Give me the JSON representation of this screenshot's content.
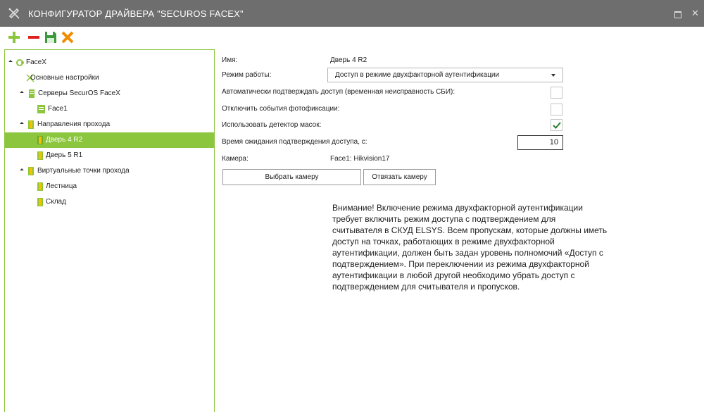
{
  "window": {
    "title": "КОНФИГУРАТОР ДРАЙВЕРА \"SECUROS FACEX\""
  },
  "toolbar": {
    "add_icon": "plus-icon",
    "remove_icon": "minus-icon",
    "save_icon": "save-icon",
    "cancel_icon": "close-icon",
    "accent": "#8cc63f"
  },
  "tree": {
    "root": "FaceX",
    "basic_settings": "Основные настройки",
    "servers": "Серверы SecurOS FaceX",
    "face1": "Face1",
    "directions": "Направления прохода",
    "door4": "Дверь 4 R2",
    "door5": "Дверь 5 R1",
    "virtual_points": "Виртуальные точки прохода",
    "stairs": "Лестница",
    "warehouse": "Склад"
  },
  "form": {
    "name_label": "Имя:",
    "name_value": "Дверь 4 R2",
    "mode_label": "Режим работы:",
    "mode_value": "Доступ в режиме двухфакторной аутентификации",
    "auto_confirm_label": "Автоматически подтверждать доступ (временная неисправность СБИ):",
    "auto_confirm_checked": false,
    "disable_photo_label": "Отключить события фотофиксации:",
    "disable_photo_checked": false,
    "mask_detector_label": "Использовать детектор масок:",
    "mask_detector_checked": true,
    "wait_time_label": "Время ожидания подтверждения доступа, с:",
    "wait_time_value": "10",
    "camera_label": "Камера:",
    "camera_value": "Face1: Hikvision17",
    "select_camera_button": "Выбрать камеру",
    "unbind_camera_button": "Отвязать камеру"
  },
  "warning_lines": [
    "Внимание! Включение режима двухфакторной аутентификации",
    "требует включить режим доступа с подтверждением для",
    "считывателя в СКУД ELSYS. Всем пропускам, которые должны иметь",
    "доступ на точках, работающих в режиме двухфакторной",
    "аутентификации, должен быть задан уровень полномочий «Доступ с",
    "подтверждением». При переключении из режима двухфакторной",
    "аутентификации в любой другой необходимо убрать доступ с",
    "подтверждением для считывателя и пропусков."
  ]
}
